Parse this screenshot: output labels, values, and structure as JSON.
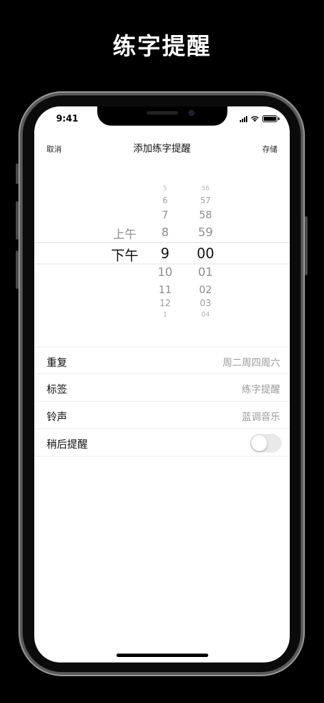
{
  "promo": {
    "title": "练字提醒"
  },
  "status_bar": {
    "time": "9:41"
  },
  "nav": {
    "cancel_label": "取消",
    "title": "添加练字提醒",
    "save_label": "存储"
  },
  "picker": {
    "ampm": {
      "above": "上午",
      "selected": "下午"
    },
    "hours": [
      "5",
      "6",
      "7",
      "8",
      "9",
      "10",
      "11",
      "12",
      "1"
    ],
    "minutes": [
      "56",
      "57",
      "58",
      "59",
      "00",
      "01",
      "02",
      "03",
      "04"
    ],
    "selected_hour": "9",
    "selected_minute": "00"
  },
  "settings": {
    "repeat": {
      "label": "重复",
      "value": "周二周四周六"
    },
    "tag": {
      "label": "标签",
      "value": "练字提醒"
    },
    "ringtone": {
      "label": "铃声",
      "value": "蓝调音乐"
    },
    "snooze": {
      "label": "稍后提醒",
      "enabled": false
    }
  },
  "colors": {
    "background": "#000000",
    "screen": "#ffffff",
    "secondary_text": "#9a9a9a",
    "toggle_off": "#e9e9eb"
  }
}
